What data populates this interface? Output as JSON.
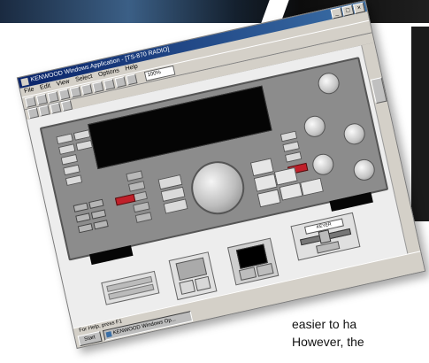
{
  "window": {
    "title": "KENWOOD Windows Application - [TS-870 RADIO]",
    "menu": [
      "File",
      "Edit",
      "View",
      "Select",
      "Options",
      "Help"
    ]
  },
  "toolbar": {
    "zoom": "100%"
  },
  "statusbar": {
    "text": "For Help, press F1",
    "start_label": "Start",
    "task_label": "KENWOOD Windows Op..."
  },
  "module_d": {
    "header": "KEYER"
  },
  "body_text": {
    "line1": "easier to ha",
    "line2": "However, the"
  }
}
